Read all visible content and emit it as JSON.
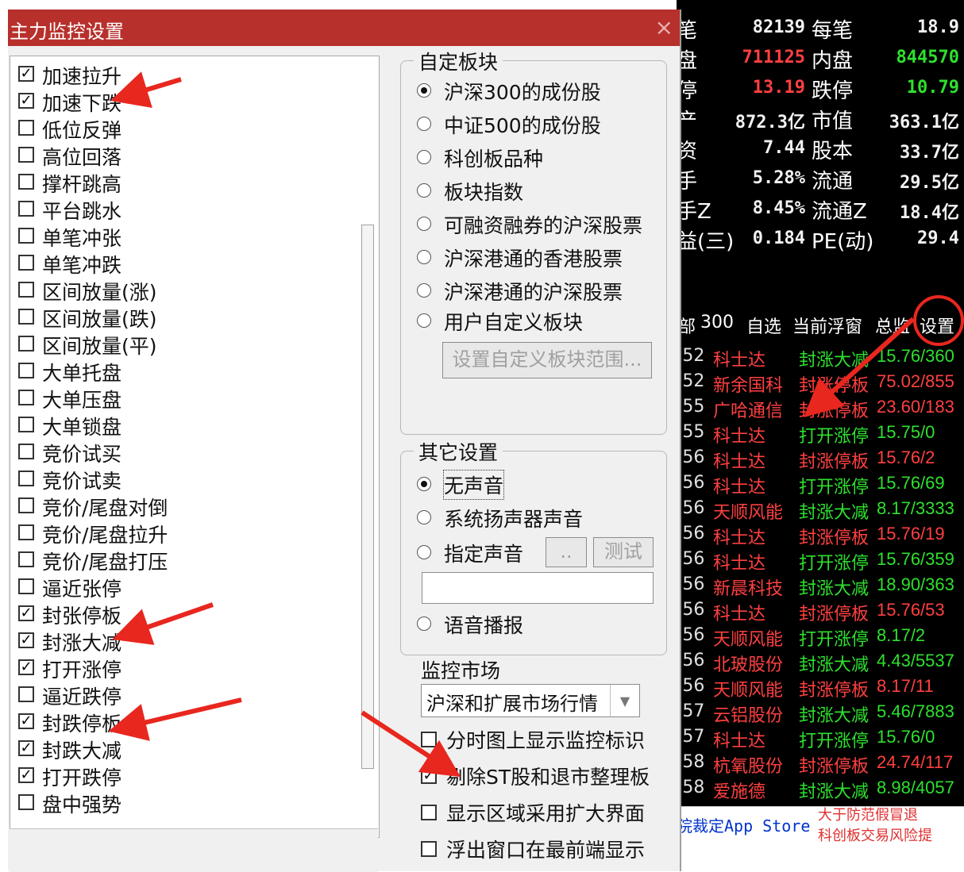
{
  "dialog": {
    "title": "主力监控设置",
    "close_glyph": "×",
    "monitor_items": [
      {
        "label": "加速拉升",
        "checked": true
      },
      {
        "label": "加速下跌",
        "checked": true
      },
      {
        "label": "低位反弹",
        "checked": false
      },
      {
        "label": "高位回落",
        "checked": false
      },
      {
        "label": "撑杆跳高",
        "checked": false
      },
      {
        "label": "平台跳水",
        "checked": false
      },
      {
        "label": "单笔冲张",
        "checked": false
      },
      {
        "label": "单笔冲跌",
        "checked": false
      },
      {
        "label": "区间放量(涨)",
        "checked": false
      },
      {
        "label": "区间放量(跌)",
        "checked": false
      },
      {
        "label": "区间放量(平)",
        "checked": false
      },
      {
        "label": "大单托盘",
        "checked": false
      },
      {
        "label": "大单压盘",
        "checked": false
      },
      {
        "label": "大单锁盘",
        "checked": false
      },
      {
        "label": "竞价试买",
        "checked": false
      },
      {
        "label": "竞价试卖",
        "checked": false
      },
      {
        "label": "竞价/尾盘对倒",
        "checked": false
      },
      {
        "label": "竞价/尾盘拉升",
        "checked": false
      },
      {
        "label": "竞价/尾盘打压",
        "checked": false
      },
      {
        "label": "逼近张停",
        "checked": false
      },
      {
        "label": "封张停板",
        "checked": true
      },
      {
        "label": "封涨大减",
        "checked": true
      },
      {
        "label": "打开涨停",
        "checked": true
      },
      {
        "label": "逼近跌停",
        "checked": false
      },
      {
        "label": "封跌停板",
        "checked": true
      },
      {
        "label": "封跌大减",
        "checked": true
      },
      {
        "label": "打开跌停",
        "checked": true
      },
      {
        "label": "盘中强势",
        "checked": false
      }
    ],
    "custom_block": {
      "legend": "自定板块",
      "options": [
        {
          "label": "沪深300的成份股",
          "selected": true
        },
        {
          "label": "中证500的成份股",
          "selected": false
        },
        {
          "label": "科创板品种",
          "selected": false
        },
        {
          "label": "板块指数",
          "selected": false
        },
        {
          "label": "可融资融券的沪深股票",
          "selected": false
        },
        {
          "label": "沪深港通的香港股票",
          "selected": false
        },
        {
          "label": "沪深港通的沪深股票",
          "selected": false
        },
        {
          "label": "用户自定义板块",
          "selected": false
        }
      ],
      "set_range_button": "设置自定义板块范围..."
    },
    "other_settings": {
      "legend": "其它设置",
      "options": [
        {
          "label": "无声音",
          "selected": true
        },
        {
          "label": "系统扬声器声音",
          "selected": false
        },
        {
          "label": "指定声音",
          "selected": false
        },
        {
          "label": "语音播报",
          "selected": false
        }
      ],
      "browse_button": "..",
      "test_button": "测试",
      "sound_path": ""
    },
    "market_label": "监控市场",
    "market_value": "沪深和扩展市场行情",
    "checkboxes": [
      {
        "label": "分时图上显示监控标识",
        "checked": false
      },
      {
        "label": "剔除ST股和退市整理板",
        "checked": true
      },
      {
        "label": "显示区域采用扩大界面",
        "checked": false
      },
      {
        "label": "浮出窗口在最前端显示",
        "checked": false
      }
    ]
  },
  "stock_panel": {
    "quote_rows": [
      {
        "l1": "笔",
        "v1": "82139",
        "c1": "white",
        "l2": "每笔",
        "v2": "18.9",
        "c2": "white"
      },
      {
        "l1": "盘",
        "v1": "711125",
        "c1": "red",
        "l2": "内盘",
        "v2": "844570",
        "c2": "green"
      },
      {
        "l1": "停",
        "v1": "13.19",
        "c1": "red",
        "l2": "跌停",
        "v2": "10.79",
        "c2": "green"
      },
      {
        "l1": "产",
        "v1": "872.3亿",
        "c1": "white",
        "l2": "市值",
        "v2": "363.1亿",
        "c2": "white"
      },
      {
        "l1": "资",
        "v1": "7.44",
        "c1": "white",
        "l2": "股本",
        "v2": "33.7亿",
        "c2": "white"
      },
      {
        "l1": "手",
        "v1": "5.28%",
        "c1": "white",
        "l2": "流通",
        "v2": "29.5亿",
        "c2": "white"
      },
      {
        "l1": "手Z",
        "v1": "8.45%",
        "c1": "white",
        "l2": "流通Z",
        "v2": "18.4亿",
        "c2": "white"
      },
      {
        "l1": "益(三)",
        "v1": "0.184",
        "c1": "white",
        "l2": "PE(动)",
        "v2": "29.4",
        "c2": "white"
      }
    ],
    "tabs": [
      "部",
      "300",
      "自选",
      "当前浮窗",
      "总监",
      "设置"
    ],
    "feed": [
      {
        "time": ":52",
        "name": "科士达",
        "event": "封涨大减",
        "ev_color": "green",
        "value": "15.76/360"
      },
      {
        "time": ":52",
        "name": "新余国科",
        "event": "封涨停板",
        "ev_color": "red",
        "value": "75.02/855"
      },
      {
        "time": ":55",
        "name": "广哈通信",
        "event": "封涨停板",
        "ev_color": "red",
        "value": "23.60/183"
      },
      {
        "time": ":55",
        "name": "科士达",
        "event": "打开涨停",
        "ev_color": "green",
        "value": "15.75/0"
      },
      {
        "time": ":56",
        "name": "科士达",
        "event": "封涨停板",
        "ev_color": "red",
        "value": "15.76/2"
      },
      {
        "time": ":56",
        "name": "科士达",
        "event": "打开涨停",
        "ev_color": "green",
        "value": "15.76/69"
      },
      {
        "time": ":56",
        "name": "天顺风能",
        "event": "封涨大减",
        "ev_color": "green",
        "value": "8.17/3333"
      },
      {
        "time": ":56",
        "name": "科士达",
        "event": "封涨停板",
        "ev_color": "red",
        "value": "15.76/19"
      },
      {
        "time": ":56",
        "name": "科士达",
        "event": "打开涨停",
        "ev_color": "green",
        "value": "15.76/359"
      },
      {
        "time": ":56",
        "name": "新晨科技",
        "event": "封涨大减",
        "ev_color": "green",
        "value": "18.90/363"
      },
      {
        "time": ":56",
        "name": "科士达",
        "event": "封涨停板",
        "ev_color": "red",
        "value": "15.76/53"
      },
      {
        "time": ":56",
        "name": "天顺风能",
        "event": "打开涨停",
        "ev_color": "green",
        "value": "8.17/2"
      },
      {
        "time": ":56",
        "name": "北玻股份",
        "event": "封涨大减",
        "ev_color": "green",
        "value": "4.43/5537"
      },
      {
        "time": ":56",
        "name": "天顺风能",
        "event": "封涨停板",
        "ev_color": "red",
        "value": "8.17/11"
      },
      {
        "time": ":57",
        "name": "云铝股份",
        "event": "封涨大减",
        "ev_color": "green",
        "value": "5.46/7883"
      },
      {
        "time": ":57",
        "name": "科士达",
        "event": "打开涨停",
        "ev_color": "green",
        "value": "15.76/0"
      },
      {
        "time": ":58",
        "name": "杭氧股份",
        "event": "封涨停板",
        "ev_color": "red",
        "value": "24.74/117"
      },
      {
        "time": ":58",
        "name": "爱施德",
        "event": "封涨大减",
        "ev_color": "green",
        "value": "8.98/4057"
      }
    ],
    "footer_app": "院裁定App Store",
    "footer_warn_1": "大于防范假冒退",
    "footer_warn_2": "科创板交易风险提"
  },
  "colors": {
    "title_bar": "#b7302c",
    "up_red": "#ff4040",
    "down_green": "#2ee02e",
    "annotation": "#e8271f"
  }
}
